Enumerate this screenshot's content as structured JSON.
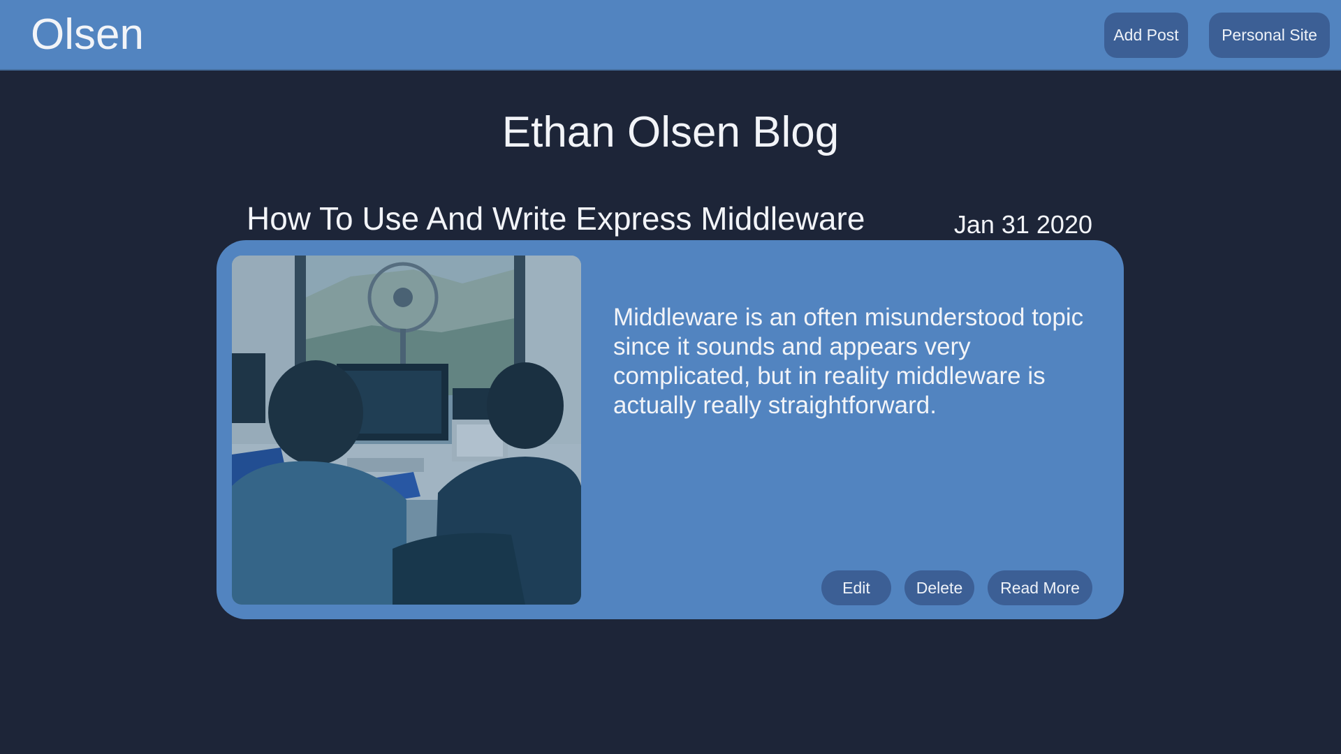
{
  "header": {
    "brand": "Olsen",
    "nav": {
      "add_post": "Add Post",
      "personal_site": "Personal Site"
    }
  },
  "blog": {
    "title": "Ethan Olsen Blog"
  },
  "post": {
    "title": "How To Use And Write Express Middleware",
    "date": "Jan 31 2020",
    "excerpt": "Middleware is an often misunderstood topic since it sounds and appears very complicated, but in reality middleware is actually really straightforward.",
    "image_alt": "two people working at computers",
    "actions": {
      "edit": "Edit",
      "delete": "Delete",
      "read_more": "Read More"
    }
  },
  "colors": {
    "background": "#1d2538",
    "accent": "#5284c0",
    "button": "#3c5f95",
    "text": "#f2f4f8"
  }
}
